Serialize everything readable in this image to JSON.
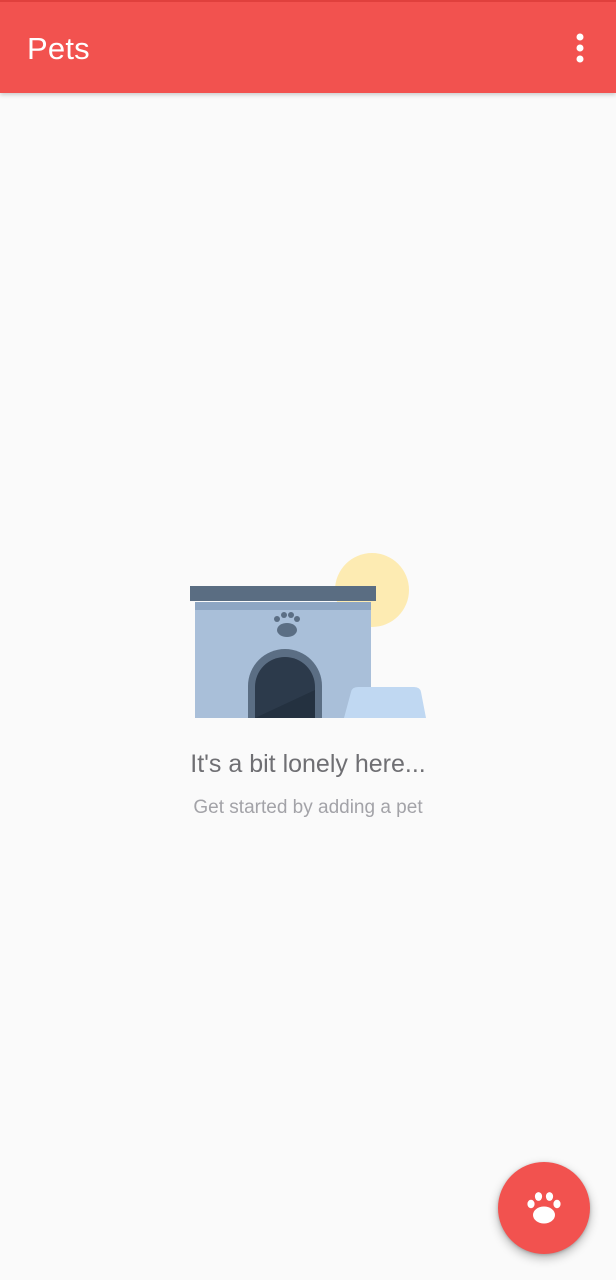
{
  "app_bar": {
    "title": "Pets",
    "menu_icon": "more-vert-icon",
    "background_color": "#f2524f"
  },
  "empty_state": {
    "illustration": "dog-house-illustration",
    "title": "It's a bit lonely here...",
    "subtitle": "Get started by adding a pet"
  },
  "fab": {
    "icon": "paw-icon",
    "color": "#f2524f"
  }
}
